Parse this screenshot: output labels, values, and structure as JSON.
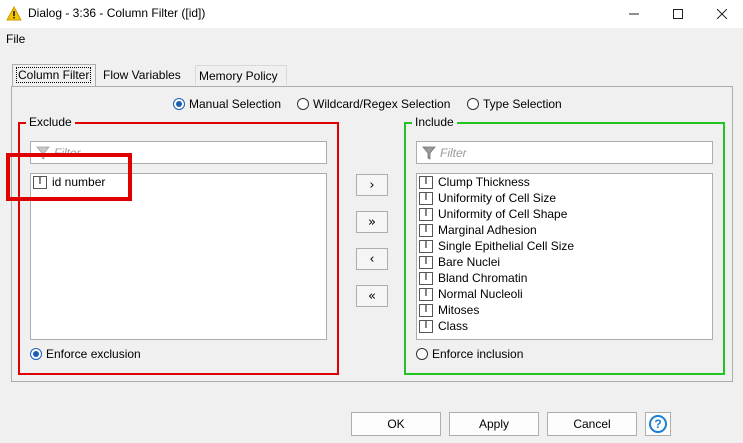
{
  "window": {
    "title": "Dialog - 3:36 - Column Filter ([id])",
    "minimize_icon": "minimize-icon",
    "maximize_icon": "maximize-icon",
    "close_icon": "close-icon"
  },
  "menu": {
    "file": "File"
  },
  "tabs": [
    {
      "label": "Column Filter",
      "active": true
    },
    {
      "label": "Flow Variables",
      "active": false
    },
    {
      "label": "Memory Policy",
      "active": false
    }
  ],
  "selection_modes": [
    {
      "label": "Manual Selection",
      "checked": true
    },
    {
      "label": "Wildcard/Regex Selection",
      "checked": false
    },
    {
      "label": "Type Selection",
      "checked": false
    }
  ],
  "exclude": {
    "legend": "Exclude",
    "border_color": "#e00000",
    "filter_placeholder": "Filter",
    "items": [
      "id number"
    ],
    "enforce_label": "Enforce exclusion",
    "enforce_checked": true
  },
  "include": {
    "legend": "Include",
    "border_color": "#22c322",
    "filter_placeholder": "Filter",
    "items": [
      "Clump Thickness",
      "Uniformity of Cell Size",
      "Uniformity of Cell Shape",
      "Marginal Adhesion",
      "Single Epithelial Cell Size",
      "Bare Nuclei",
      "Bland Chromatin",
      "Normal Nucleoli",
      "Mitoses",
      "Class"
    ],
    "enforce_label": "Enforce inclusion",
    "enforce_checked": false
  },
  "column_type_glyph": "I",
  "move_buttons": {
    "add": "›",
    "add_all": "»",
    "remove": "‹",
    "remove_all": "«"
  },
  "buttons": {
    "ok": "OK",
    "apply": "Apply",
    "cancel": "Cancel",
    "help": "?"
  },
  "colors": {
    "highlight": "#e00000",
    "accent": "#1a5fb4",
    "help": "#1a7fd4"
  }
}
